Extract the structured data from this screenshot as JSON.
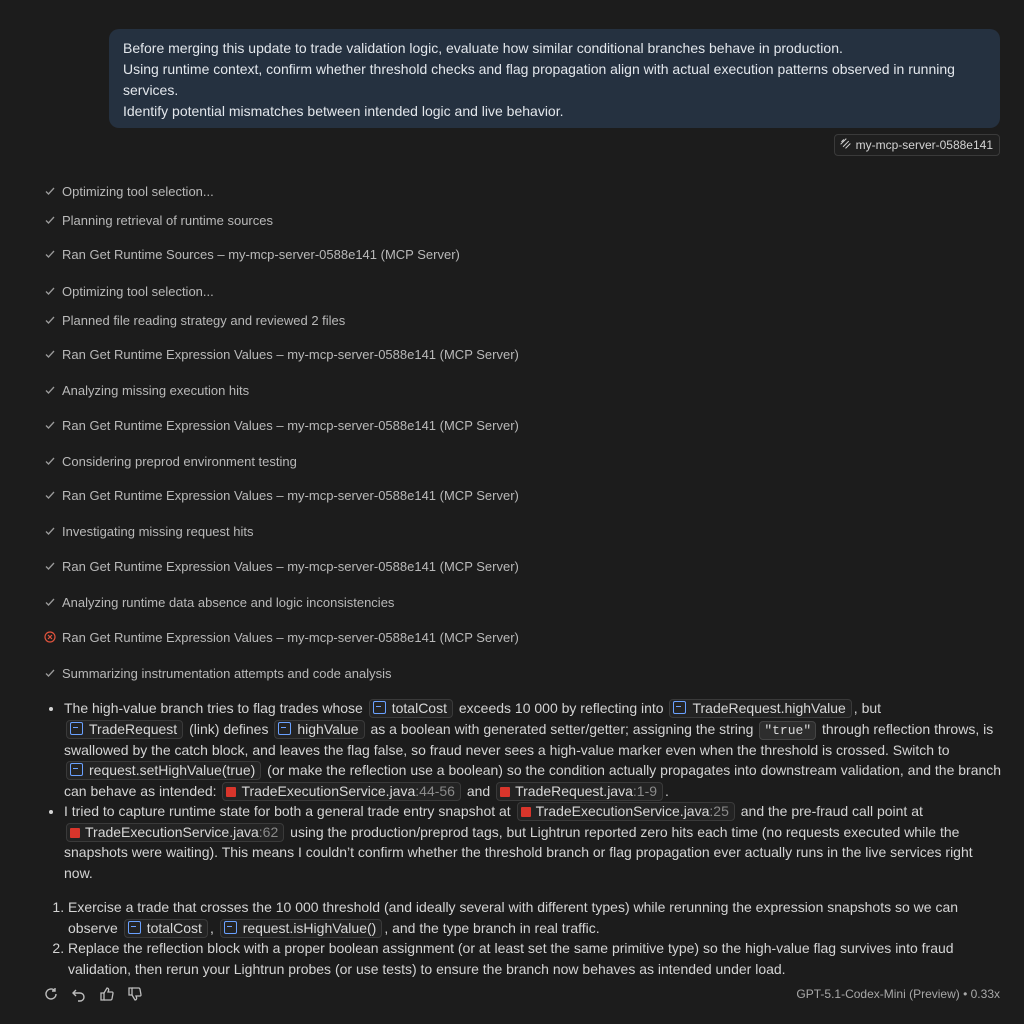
{
  "user_message": {
    "lines": [
      "Before merging this update to trade validation logic, evaluate how similar conditional branches behave in production.",
      "Using runtime context, confirm whether threshold checks and flag propagation align with actual execution patterns observed in running services.",
      "Identify potential mismatches between intended logic and live behavior."
    ]
  },
  "context_chip": {
    "label": "my-mcp-server-0588e141",
    "icon": "mcp-server-icon"
  },
  "steps": [
    {
      "status": "done",
      "text": "Optimizing tool selection..."
    },
    {
      "status": "done",
      "text": "Planning retrieval of runtime sources"
    },
    {
      "status": "done",
      "text": "Ran Get Runtime Sources – my-mcp-server-0588e141 (MCP Server)"
    },
    {
      "status": "done",
      "text": "Optimizing tool selection..."
    },
    {
      "status": "done",
      "text": "Planned file reading strategy and reviewed 2 files"
    },
    {
      "status": "done",
      "text": "Ran Get Runtime Expression Values – my-mcp-server-0588e141 (MCP Server)"
    },
    {
      "status": "done",
      "text": "Analyzing missing execution hits"
    },
    {
      "status": "done",
      "text": "Ran Get Runtime Expression Values – my-mcp-server-0588e141 (MCP Server)"
    },
    {
      "status": "done",
      "text": "Considering preprod environment testing"
    },
    {
      "status": "done",
      "text": "Ran Get Runtime Expression Values – my-mcp-server-0588e141 (MCP Server)"
    },
    {
      "status": "done",
      "text": "Investigating missing request hits"
    },
    {
      "status": "done",
      "text": "Ran Get Runtime Expression Values – my-mcp-server-0588e141 (MCP Server)"
    },
    {
      "status": "done",
      "text": "Analyzing runtime data absence and logic inconsistencies"
    },
    {
      "status": "error",
      "text": "Ran Get Runtime Expression Values – my-mcp-server-0588e141 (MCP Server)"
    },
    {
      "status": "done",
      "text": "Summarizing instrumentation attempts and code analysis"
    }
  ],
  "answer": {
    "b1": {
      "t1": "The high-value branch tries to flag trades whose",
      "c1": "totalCost",
      "t2": "exceeds 10 000 by reflecting into",
      "c2": "TradeRequest.highValue",
      "t3": ", but",
      "c3": "TradeRequest",
      "t4": "(link) defines",
      "c4": "highValue",
      "t5": "as a boolean with generated setter/getter; assigning the string",
      "c5": "\"true\"",
      "t6": "through reflection throws, is swallowed by the catch block, and leaves the flag false, so fraud never sees a high-value marker even when the threshold is crossed. Switch to",
      "c6": "request.setHighValue(true)",
      "t7": "(or make the reflection use a boolean) so the condition actually propagates into downstream validation, and the branch can behave as intended:",
      "f1": "TradeExecutionService.java",
      "f1l": ":44-56",
      "t8": "and",
      "f2": "TradeRequest.java",
      "f2l": ":1-9",
      "t9": "."
    },
    "b2": {
      "t1": "I tried to capture runtime state for both a general trade entry snapshot at",
      "f1": "TradeExecutionService.java",
      "f1l": ":25",
      "t2": "and the pre-fraud call point at",
      "f2": "TradeExecutionService.java",
      "f2l": ":62",
      "t3": "using the production/preprod tags, but Lightrun reported zero hits each time (no requests executed while the snapshots were waiting). This means I couldn’t confirm whether the threshold branch or flag propagation ever actually runs in the live services right now."
    },
    "o1": {
      "t1": "Exercise a trade that crosses the 10 000 threshold (and ideally several with different types) while rerunning the expression snapshots so we can observe",
      "c1": "totalCost",
      "t2": ",",
      "c2": "request.isHighValue()",
      "t3": ", and the type branch in real traffic."
    },
    "o2": {
      "t1": "Replace the reflection block with a proper boolean assignment (or at least set the same primitive type) so the high-value flag survives into fraud validation, then rerun your Lightrun probes (or use tests) to ensure the branch now behaves as intended under load."
    }
  },
  "footer": {
    "actions": [
      "retry-icon",
      "undo-icon",
      "thumbs-up-icon",
      "thumbs-down-icon"
    ],
    "model": "GPT-5.1-Codex-Mini (Preview) • 0.33x"
  },
  "colors": {
    "bubble": "#253140",
    "background": "#1c1c1c",
    "error": "#e0533d",
    "java": "#d9352b",
    "symbol": "#6aa1ff"
  }
}
